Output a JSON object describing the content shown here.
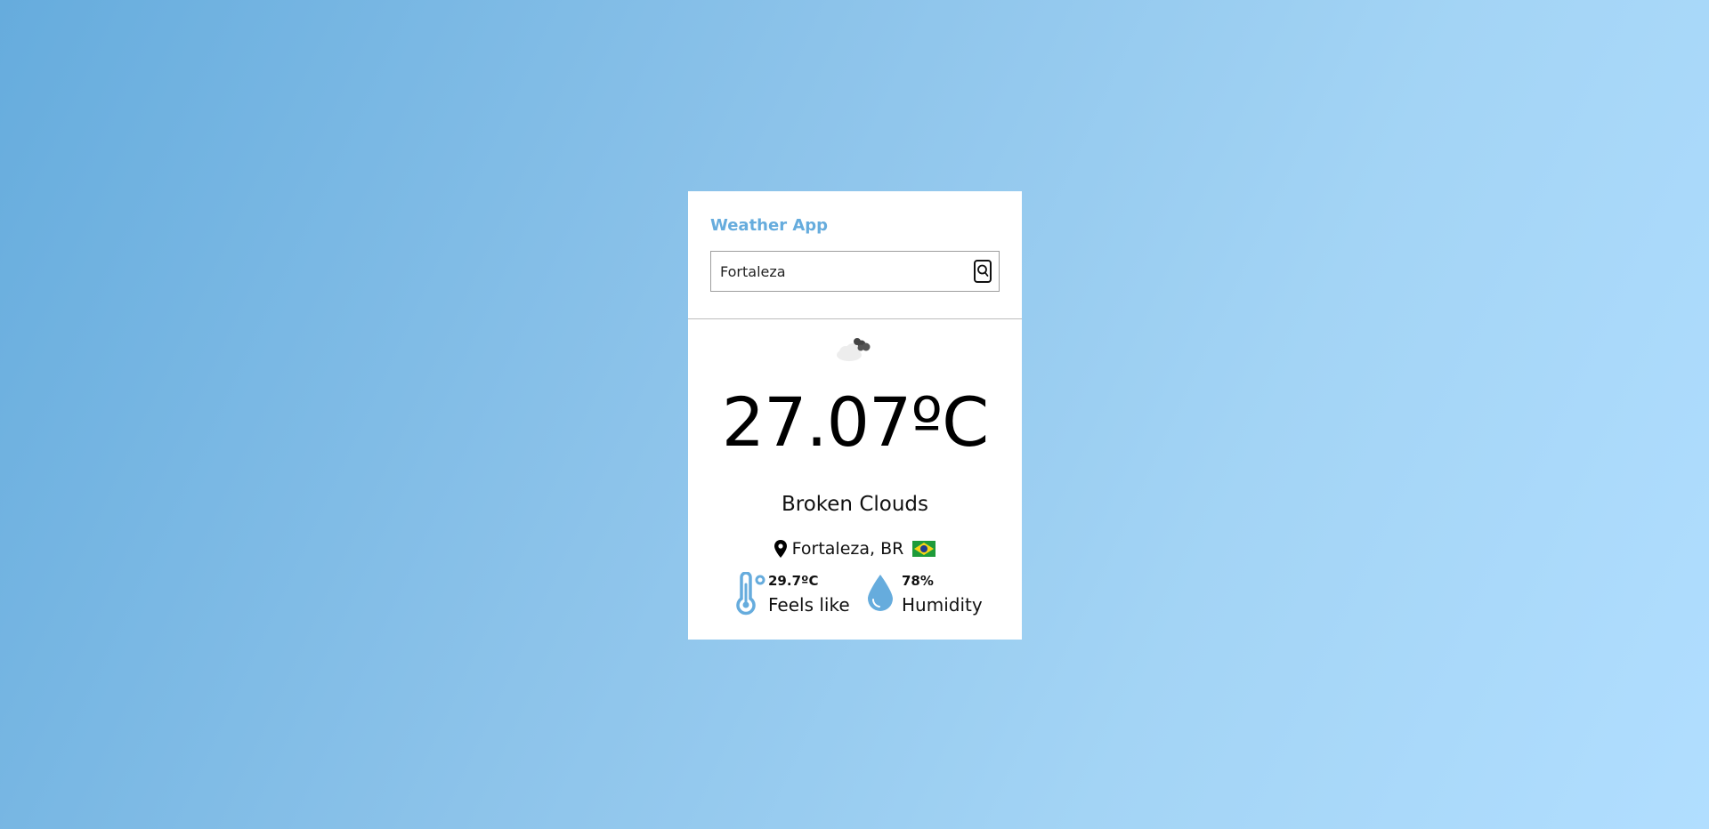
{
  "app": {
    "title": "Weather App"
  },
  "search": {
    "value": "Fortaleza",
    "button_icon": "search-icon"
  },
  "weather": {
    "icon": "broken-clouds-icon",
    "temperature": "27.07ºC",
    "description": "Broken Clouds",
    "location": "Fortaleza, BR",
    "location_icon": "map-pin-icon",
    "flag_icon": "brazil-flag-icon"
  },
  "details": {
    "feels_like": {
      "value": "29.7ºC",
      "label": "Feels like",
      "icon": "thermometer-icon"
    },
    "humidity": {
      "value": "78%",
      "label": "Humidity",
      "icon": "water-drop-icon"
    }
  },
  "colors": {
    "accent": "#66acdd",
    "background_start": "#66acdd",
    "background_end": "#b1deff"
  }
}
